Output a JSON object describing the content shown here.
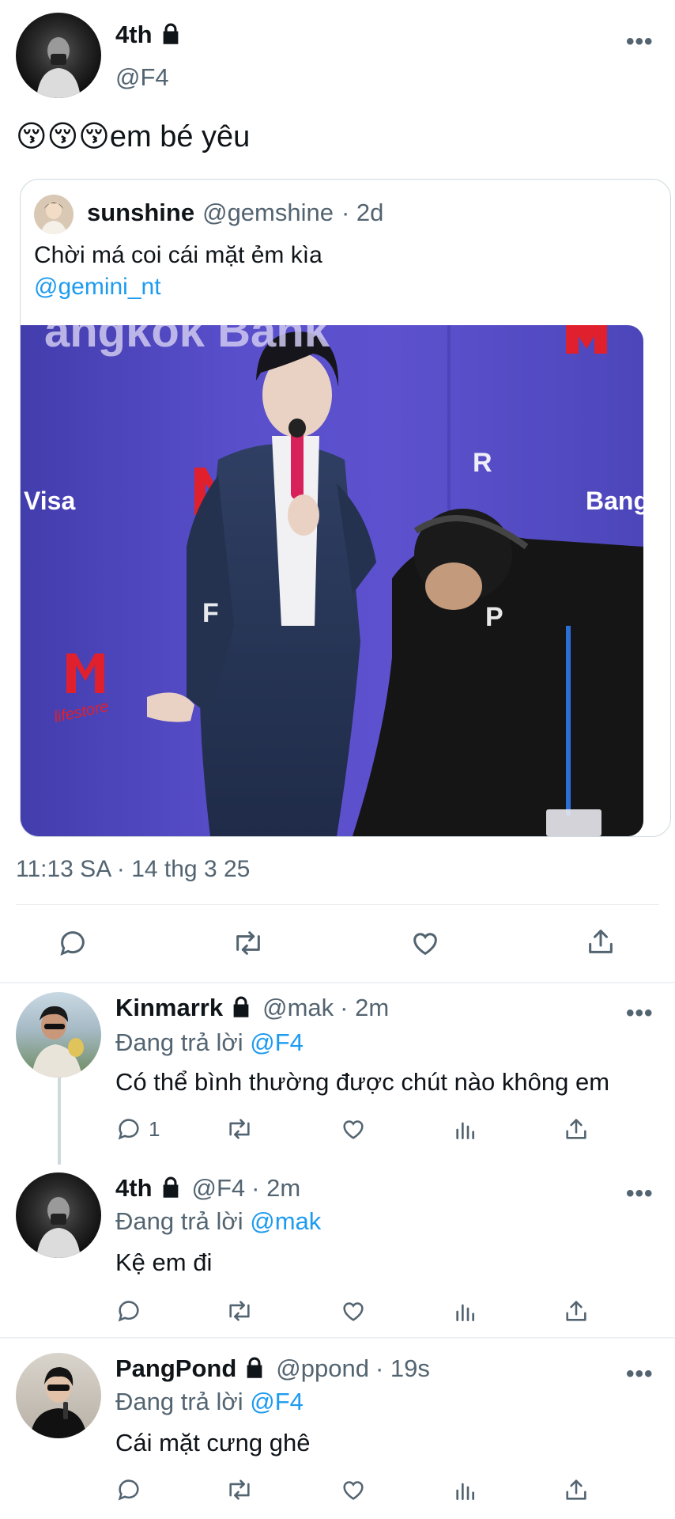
{
  "main_tweet": {
    "author_name": "4th",
    "handle": "@F4",
    "emoji": "😚😚😚",
    "text": "em bé yêu",
    "more": "•••",
    "quoted": {
      "author_name": "sunshine",
      "handle": "@gemshine",
      "time": "· 2d",
      "text": "Chời má coi cái mặt ẻm kìa",
      "mention": "@gemini_nt",
      "photo_text": {
        "banner": "angkok Bank",
        "visa": "Visa",
        "bang": "Bang",
        "m_logo": "M",
        "lifestore": "lifestore"
      }
    },
    "timestamp": "11:13 SA · 14 thg 3 25"
  },
  "replies": [
    {
      "author_name": "Kinmarrk",
      "handle": "@mak",
      "time": "· 2m",
      "replying_prefix": "Đang trả lời",
      "replying_to": "@F4",
      "text": "Có thể bình thường được chút nào không em",
      "reply_count": "1"
    },
    {
      "author_name": "4th",
      "handle": "@F4",
      "time": "· 2m",
      "replying_prefix": "Đang trả lời",
      "replying_to": "@mak",
      "text": "Kệ em đi",
      "reply_count": ""
    },
    {
      "author_name": "PangPond",
      "handle": "@ppond",
      "time": "· 19s",
      "replying_prefix": "Đang trả lời",
      "replying_to": "@F4",
      "text": "Cái mặt cưng ghê",
      "reply_count": ""
    }
  ],
  "colors": {
    "accent": "#1d9bf0",
    "text": "#0f1419",
    "muted": "#536471",
    "photo_bg": "#5b4fc4"
  }
}
